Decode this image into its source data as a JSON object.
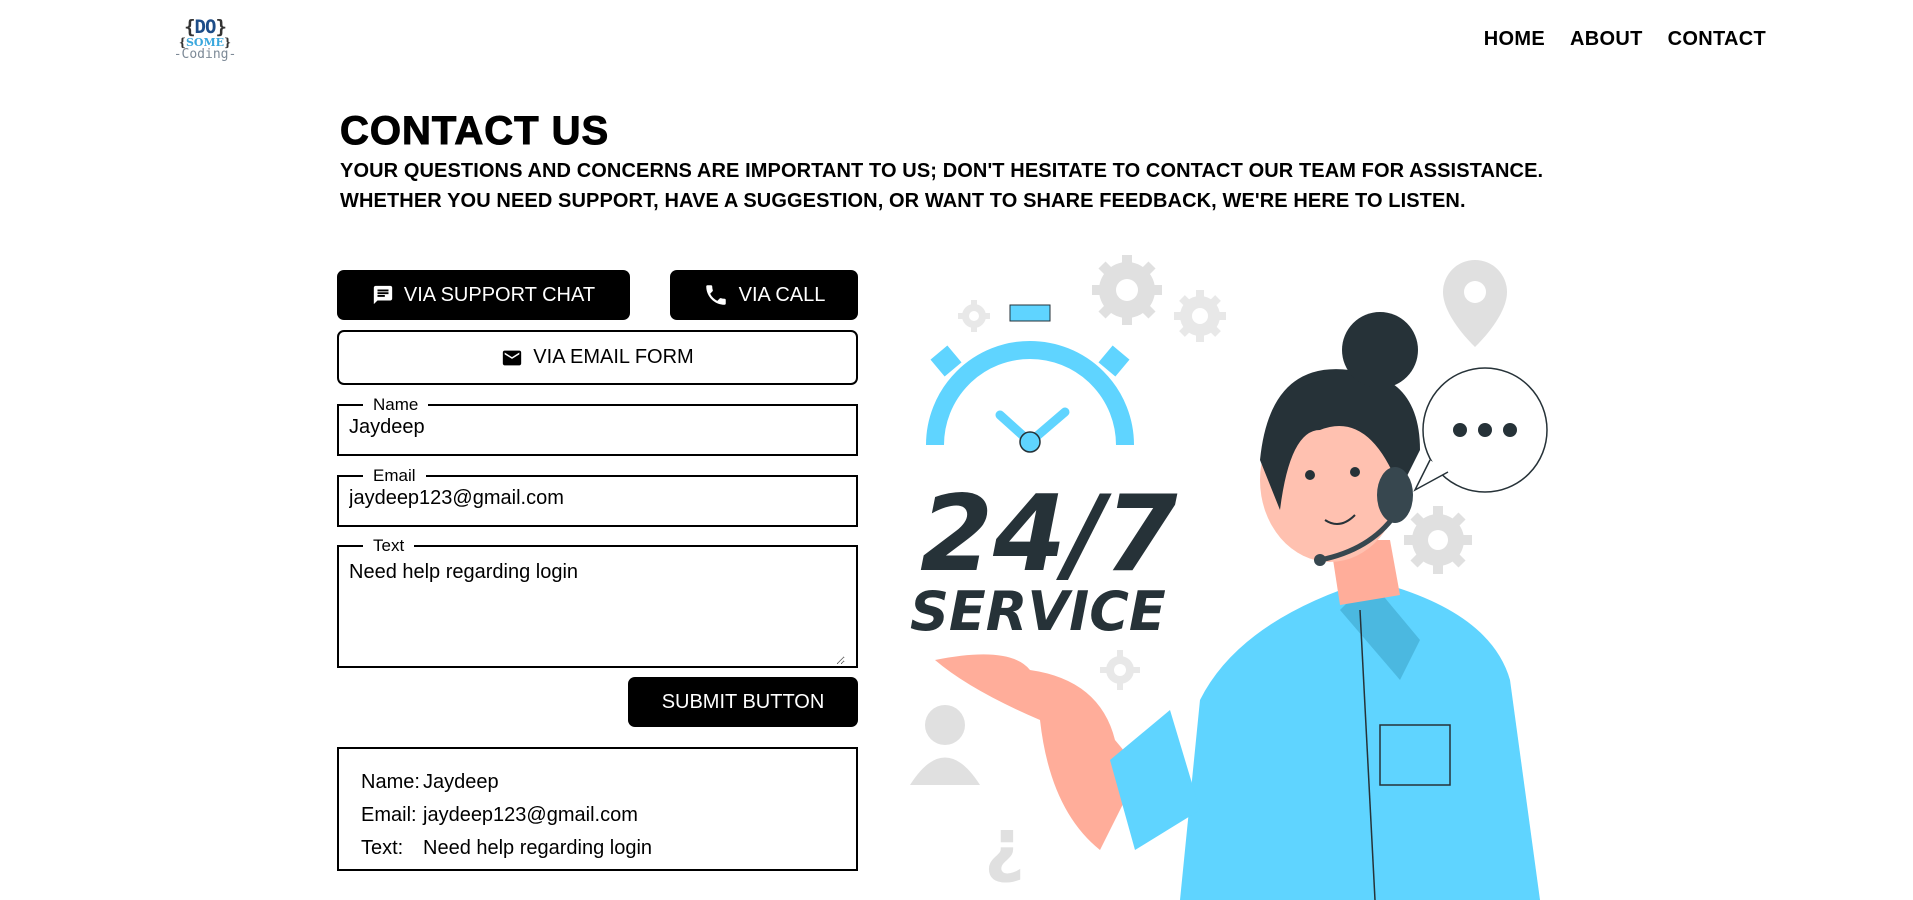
{
  "logo": {
    "line1": "DO",
    "line2": "SOME",
    "line3": "Coding",
    "brace_open": "{",
    "brace_close": "}",
    "dash": "-"
  },
  "nav": {
    "items": [
      "HOME",
      "ABOUT",
      "CONTACT"
    ]
  },
  "heading": {
    "title": "CONTACT US",
    "line1": "YOUR QUESTIONS AND CONCERNS ARE IMPORTANT TO US; DON'T HESITATE TO CONTACT OUR TEAM FOR ASSISTANCE.",
    "line2": "WHETHER YOU NEED SUPPORT, HAVE A SUGGESTION, OR WANT TO SHARE FEEDBACK, WE'RE HERE TO LISTEN."
  },
  "buttons": {
    "chat": {
      "label": "VIA SUPPORT CHAT",
      "icon": "chat-icon"
    },
    "call": {
      "label": "VIA CALL",
      "icon": "phone-icon"
    },
    "email": {
      "label": "VIA EMAIL FORM",
      "icon": "mail-icon"
    },
    "submit": {
      "label": "SUBMIT BUTTON"
    }
  },
  "form": {
    "name": {
      "legend": "Name",
      "value": "Jaydeep"
    },
    "email": {
      "legend": "Email",
      "value": "jaydeep123@gmail.com"
    },
    "text": {
      "legend": "Text",
      "value": "Need help regarding login"
    }
  },
  "result": {
    "name_label": "Name:",
    "name_value": "Jaydeep",
    "email_label": "Email:",
    "email_value": "jaydeep123@gmail.com",
    "text_label": "Text:",
    "text_value": "Need help regarding login"
  },
  "illustration": {
    "line1": "24/7",
    "line2": "SERVICE",
    "accent_color": "#5fd4ff",
    "dark_color": "#263238"
  }
}
